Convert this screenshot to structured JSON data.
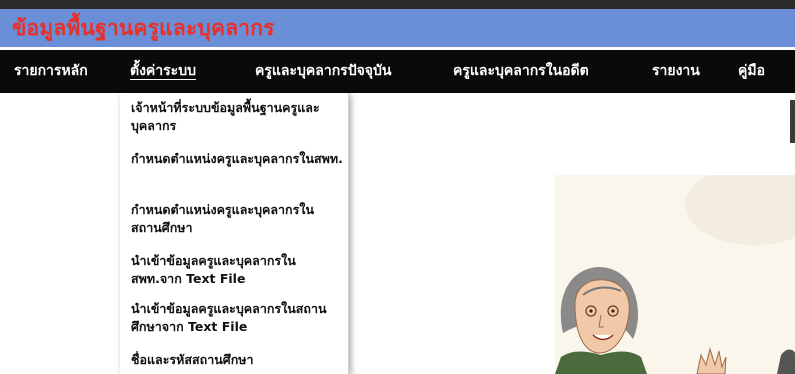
{
  "header": {
    "title": "ข้อมูลพื้นฐานครูและบุคลากร",
    "title_color": "#e8302a",
    "background": "#6b8fd6"
  },
  "nav": {
    "items": [
      {
        "label": "รายการหลัก"
      },
      {
        "label": "ตั้งค่าระบบ",
        "active": true
      },
      {
        "label": "ครูและบุคลากรปัจจุบัน"
      },
      {
        "label": "ครูและบุคลากรในอดีต"
      },
      {
        "label": "รายงาน"
      },
      {
        "label": "คู่มือ"
      }
    ]
  },
  "dropdown": {
    "items": [
      {
        "label": "เจ้าหน้าที่ระบบข้อมูลพื้นฐานครูและบุคลากร"
      },
      {
        "label": "กำหนดตำแหน่งครูและบุคลากรในสพท."
      },
      {
        "label": "กำหนดตำแหน่งครูและบุคลากรในสถานศึกษา"
      },
      {
        "label": "นำเข้าข้อมูลครูและบุคลากรในสพท.จาก Text File"
      },
      {
        "label": "นำเข้าข้อมูลครูและบุคลากรในสถานศึกษาจาก Text File"
      },
      {
        "label": "ชื่อและรหัสสถานศึกษา"
      }
    ]
  }
}
